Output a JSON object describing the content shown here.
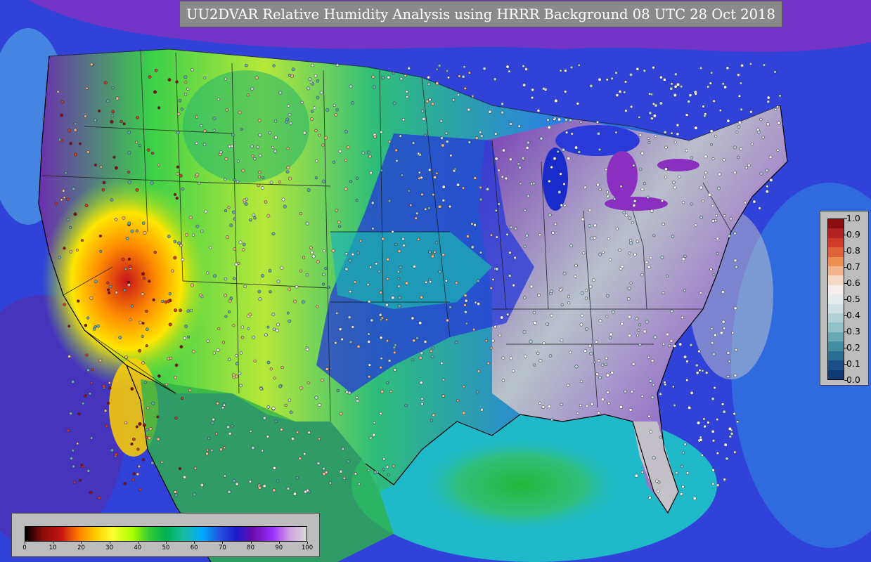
{
  "title": "UU2DVAR Relative Humidity Analysis using HRRR Background 08 UTC 28 Oct 2018",
  "station_colorbar": {
    "ticks": [
      "1.0",
      "0.9",
      "0.8",
      "0.7",
      "0.6",
      "0.5",
      "0.4",
      "0.3",
      "0.2",
      "0.1",
      "0.0"
    ],
    "colors": [
      "#8b0f12",
      "#b22222",
      "#cf3b2a",
      "#e0623a",
      "#ec8f52",
      "#f2b48c",
      "#f6d8c6",
      "#f4efec",
      "#e6ecec",
      "#cfe1e2",
      "#b4d3d6",
      "#93c2c8",
      "#6aaab5",
      "#438e9f",
      "#2a6f92",
      "#1b4f85",
      "#123a72"
    ]
  },
  "rh_colorbar": {
    "ticks": [
      "0",
      "10",
      "20",
      "30",
      "40",
      "50",
      "60",
      "70",
      "80",
      "90",
      "100"
    ],
    "colors": [
      "#000000",
      "#8b0a0a",
      "#c81414",
      "#ff7f00",
      "#ffcc00",
      "#ffff33",
      "#aaff00",
      "#33cc33",
      "#00b050",
      "#1abc9c",
      "#00aaff",
      "#2255dd",
      "#1a1acc",
      "#6a0dad",
      "#9b30ff",
      "#d0a0e0",
      "#d9d9d9"
    ]
  },
  "colors": {
    "ocean_deep": "#2b3fd8",
    "gulf_teal": "#1fb9c9",
    "gulf_green": "#3cb84a",
    "land_dry": "#ff9900",
    "land_wet": "#c8c8c8",
    "boundary": "#1a1a1a"
  }
}
